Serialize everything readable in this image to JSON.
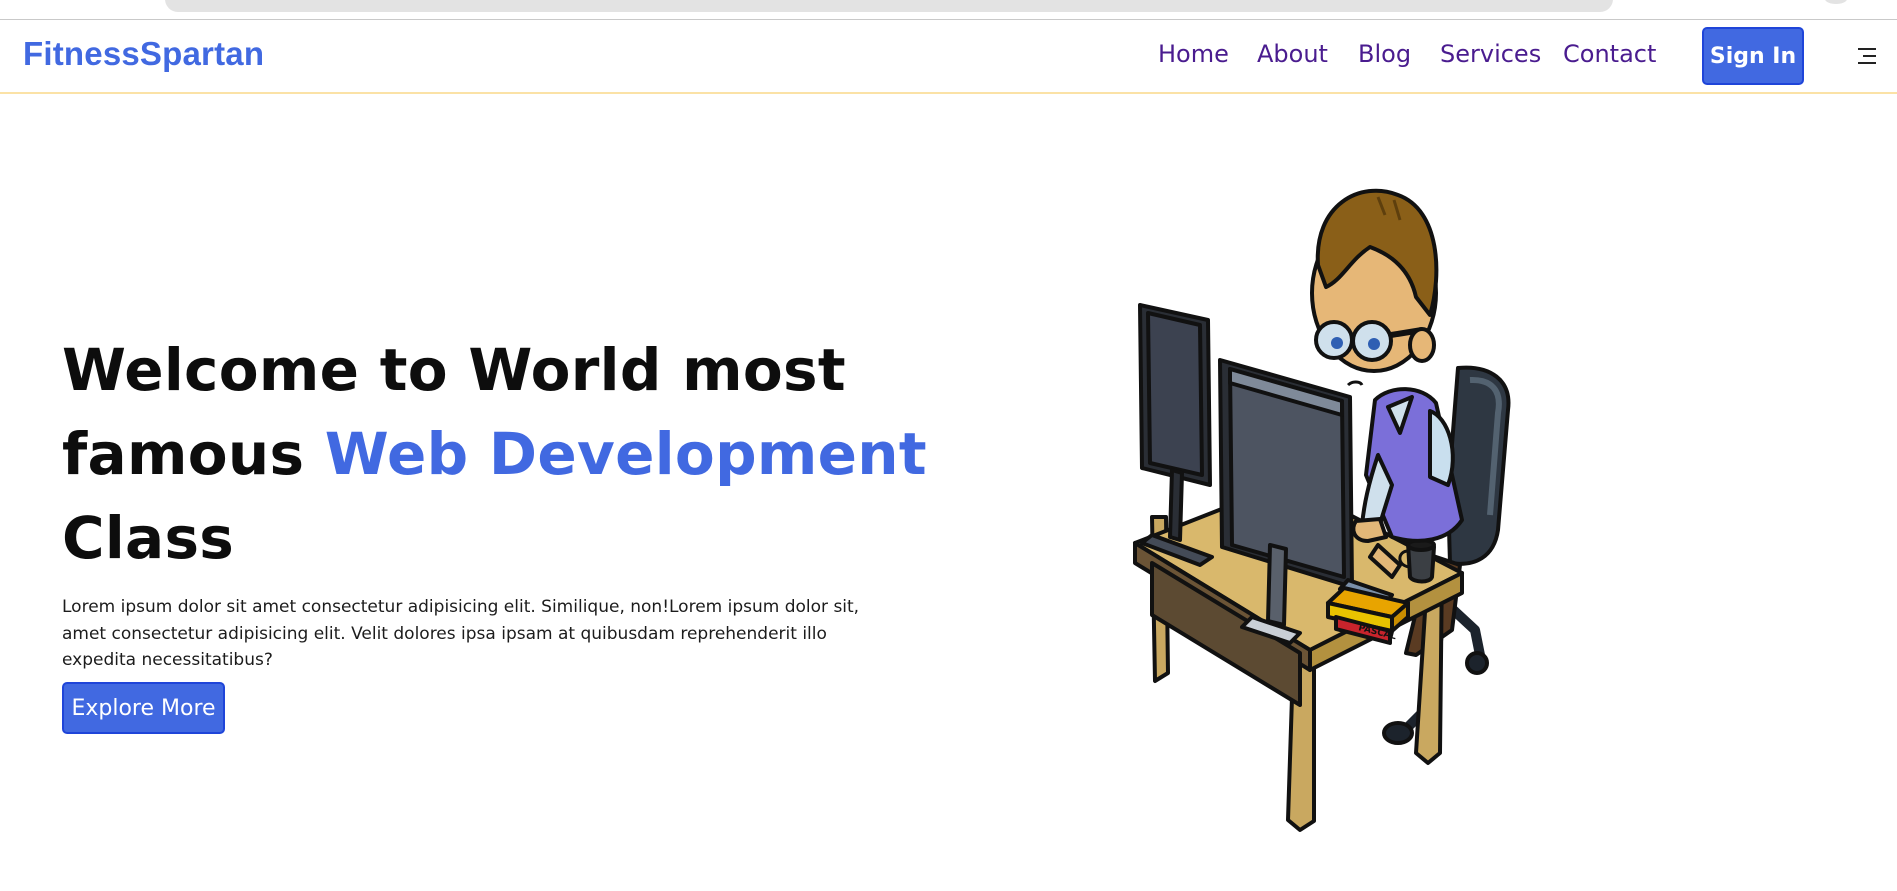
{
  "navbar": {
    "brand": "FitnessSpartan",
    "links": [
      "Home",
      "About",
      "Blog",
      "Services",
      "Contact"
    ],
    "signin_label": "Sign In",
    "menu_icon": "hamburger-menu-icon"
  },
  "hero": {
    "title_part1": "Welcome to World most famous ",
    "title_accent": "Web Development",
    "title_part2": " Class",
    "description": "Lorem ipsum dolor sit amet consectetur adipisicing elit. Similique, non!Lorem ipsum dolor sit, amet consectetur adipisicing elit. Velit dolores ipsa ipsam at quibusdam reprehenderit illo expedita necessitatibus?",
    "explore_label": "Explore More"
  },
  "illustration": {
    "book_label": "PASCAL"
  },
  "colors": {
    "accent": "#4169e1",
    "nav_link": "#4a1c8f",
    "nav_border": "#fbe2a6",
    "heading": "#0d0d0d"
  }
}
